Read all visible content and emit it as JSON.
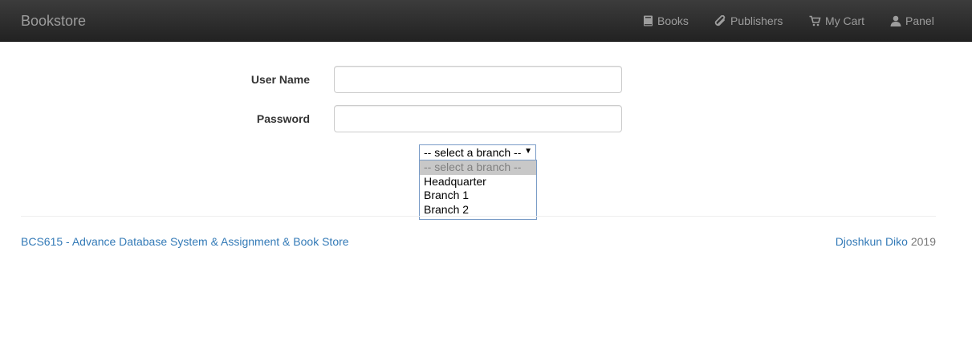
{
  "navbar": {
    "brand": "Bookstore",
    "items": [
      {
        "label": "Books",
        "icon": "book-icon"
      },
      {
        "label": "Publishers",
        "icon": "paperclip-icon"
      },
      {
        "label": "My Cart",
        "icon": "cart-icon"
      },
      {
        "label": "Panel",
        "icon": "user-icon"
      }
    ]
  },
  "form": {
    "username_label": "User Name",
    "username_value": "",
    "password_label": "Password",
    "password_value": "",
    "branch_select": {
      "selected": "-- select a branch --",
      "options": [
        "-- select a branch --",
        "Headquarter",
        "Branch 1",
        "Branch 2"
      ]
    }
  },
  "footer": {
    "left_link": "BCS615 - Advance Database System & Assignment & Book Store",
    "author": "Djoshkun Diko",
    "year": "2019"
  },
  "colors": {
    "navbar_bg": "#222222",
    "nav_text": "#9d9d9d",
    "link": "#337ab7"
  }
}
